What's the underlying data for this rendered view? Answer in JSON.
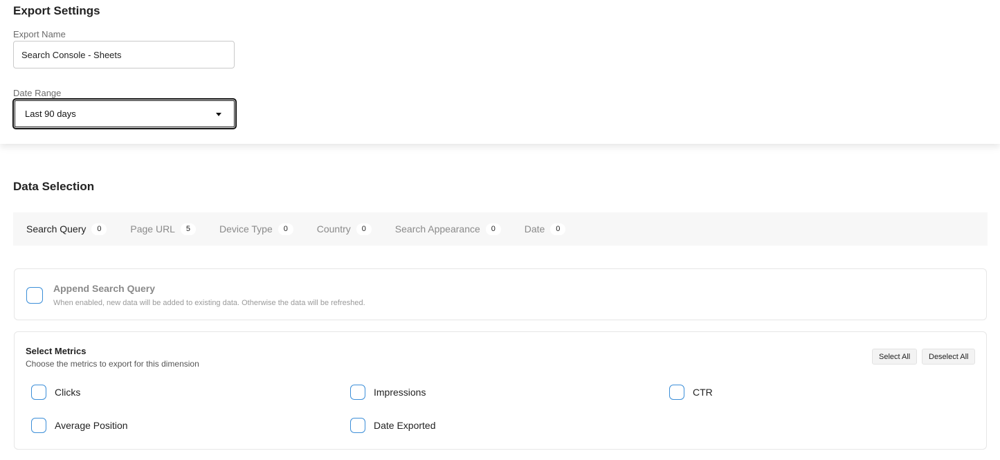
{
  "export_settings": {
    "title": "Export Settings",
    "export_name_label": "Export Name",
    "export_name_value": "Search Console - Sheets",
    "date_range_label": "Date Range",
    "date_range_value": "Last 90 days"
  },
  "data_selection": {
    "title": "Data Selection",
    "tabs": [
      {
        "label": "Search Query",
        "count": "0"
      },
      {
        "label": "Page URL",
        "count": "5"
      },
      {
        "label": "Device Type",
        "count": "0"
      },
      {
        "label": "Country",
        "count": "0"
      },
      {
        "label": "Search Appearance",
        "count": "0"
      },
      {
        "label": "Date",
        "count": "0"
      }
    ],
    "append": {
      "title": "Append Search Query",
      "description": "When enabled, new data will be added to existing data. Otherwise the data will be refreshed."
    },
    "metrics": {
      "title": "Select Metrics",
      "description": "Choose the metrics to export for this dimension",
      "select_all_label": "Select All",
      "deselect_all_label": "Deselect All",
      "items": [
        "Clicks",
        "Impressions",
        "CTR",
        "Average Position",
        "Date Exported"
      ]
    }
  },
  "colors": {
    "checkbox_border": "#3b8ed8",
    "tabs_background": "#f7f7f7"
  }
}
